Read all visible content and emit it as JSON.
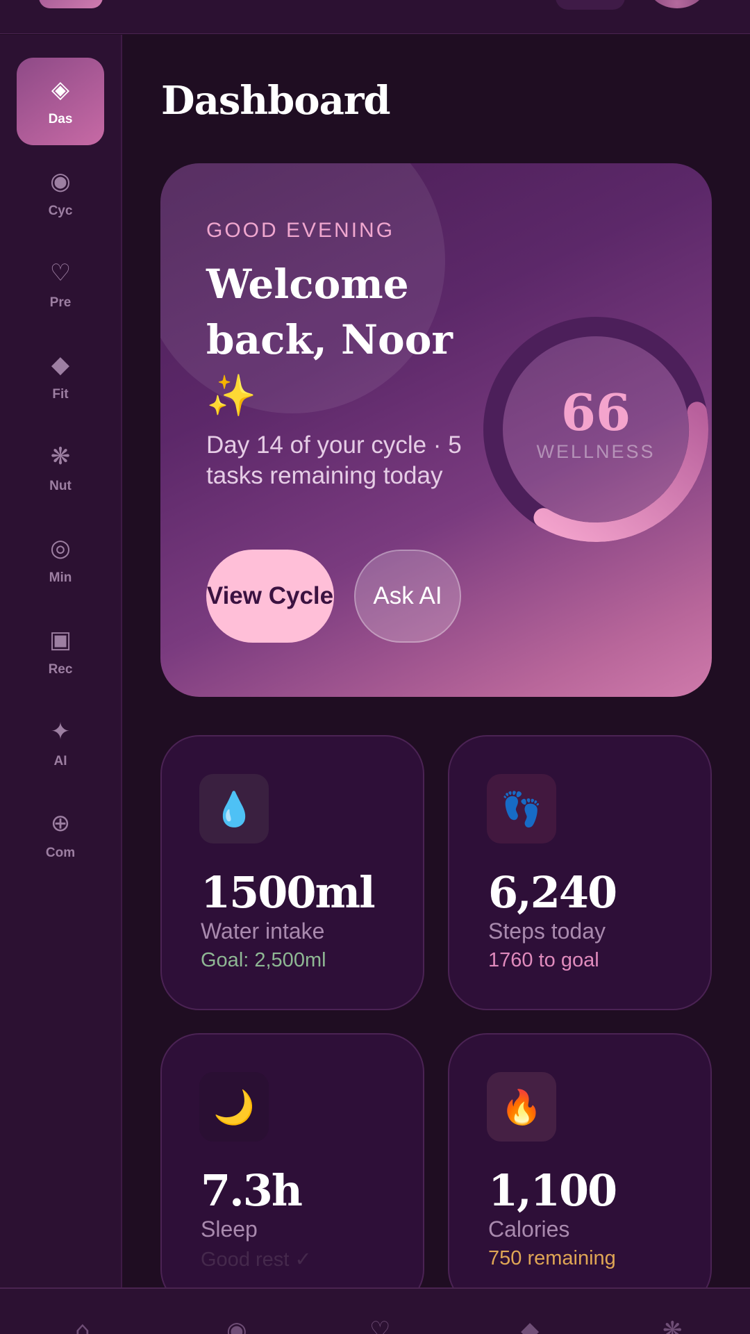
{
  "page": {
    "title": "Dashboard"
  },
  "sidebar": {
    "items": [
      {
        "label": "Das",
        "icon": "◈",
        "icon_name": "diamond-icon",
        "active": true
      },
      {
        "label": "Cyc",
        "icon": "◉",
        "icon_name": "target-icon"
      },
      {
        "label": "Pre",
        "icon": "♡",
        "icon_name": "heart-icon"
      },
      {
        "label": "Fit",
        "icon": "◆",
        "icon_name": "filled-diamond-icon"
      },
      {
        "label": "Nut",
        "icon": "❋",
        "icon_name": "flower-icon"
      },
      {
        "label": "Min",
        "icon": "◎",
        "icon_name": "bullseye-icon"
      },
      {
        "label": "Rec",
        "icon": "▣",
        "icon_name": "square-icon"
      },
      {
        "label": "AI",
        "icon": "✦",
        "icon_name": "sparkle-icon"
      },
      {
        "label": "Com",
        "icon": "⊕",
        "icon_name": "globe-icon"
      }
    ]
  },
  "hero": {
    "greeting": "GOOD EVENING",
    "welcome": "Welcome back, Noor ✨",
    "subtitle": "Day 14 of your cycle · 5 tasks remaining today",
    "primary_button": "View Cycle",
    "secondary_button": "Ask AI",
    "wellness": {
      "value": "66",
      "label": "WELLNESS",
      "fraction": 0.66
    }
  },
  "stats": [
    {
      "icon": "💧",
      "icon_name": "water-drop-icon",
      "icon_bg": "#3a2040",
      "value": "1500ml",
      "label": "Water intake",
      "note": "Goal: 2,500ml",
      "note_color": "#8fb894"
    },
    {
      "icon": "👣",
      "icon_name": "footprints-icon",
      "icon_bg": "#42183f",
      "value": "6,240",
      "label": "Steps today",
      "note": "1760 to goal",
      "note_color": "#e08bbd"
    },
    {
      "icon": "🌙",
      "icon_name": "moon-icon",
      "icon_bg": "#2a0f33",
      "value": "7.3h",
      "label": "Sleep",
      "note": "Good rest ✓",
      "note_color": "#45294c"
    },
    {
      "icon": "🔥",
      "icon_name": "fire-icon",
      "icon_bg": "#452044",
      "value": "1,100",
      "label": "Calories",
      "note": "750 remaining",
      "note_color": "#e0a655"
    }
  ],
  "colors": {
    "accent": "#ffbfd8",
    "background": "#1f0d22",
    "sidebar": "#2c1132"
  }
}
